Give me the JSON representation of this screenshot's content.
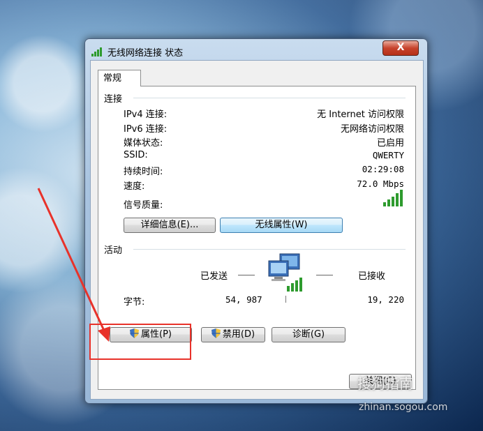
{
  "window": {
    "title": "无线网络连接 状态",
    "close_label": "X",
    "tab_general": "常规",
    "close_button_label": "关闭(C)"
  },
  "connection": {
    "heading": "连接",
    "rows": [
      {
        "key": "IPv4 连接:",
        "value": "无 Internet 访问权限"
      },
      {
        "key": "IPv6 连接:",
        "value": "无网络访问权限"
      },
      {
        "key": "媒体状态:",
        "value": "已启用"
      },
      {
        "key": "SSID:",
        "value": "QWERTY"
      },
      {
        "key": "持续时间:",
        "value": "02:29:08"
      },
      {
        "key": "速度:",
        "value": "72.0 Mbps"
      }
    ],
    "signal_label": "信号质量:",
    "details_button": "详细信息(E)...",
    "wireless_props_button": "无线属性(W)"
  },
  "activity": {
    "heading": "活动",
    "sent_label": "已发送",
    "received_label": "已接收",
    "bytes_label": "字节:",
    "bytes_sent": "54, 987",
    "bytes_received": "19, 220"
  },
  "actions": {
    "properties_button": "属性(P)",
    "disable_button": "禁用(D)",
    "diagnose_button": "诊断(G)"
  },
  "watermark": {
    "brand": "搜狗指南",
    "url": "zhinan.sogou.com"
  },
  "colors": {
    "highlight_box": "#e8322a",
    "signal_bars": "#2e9b2e"
  }
}
